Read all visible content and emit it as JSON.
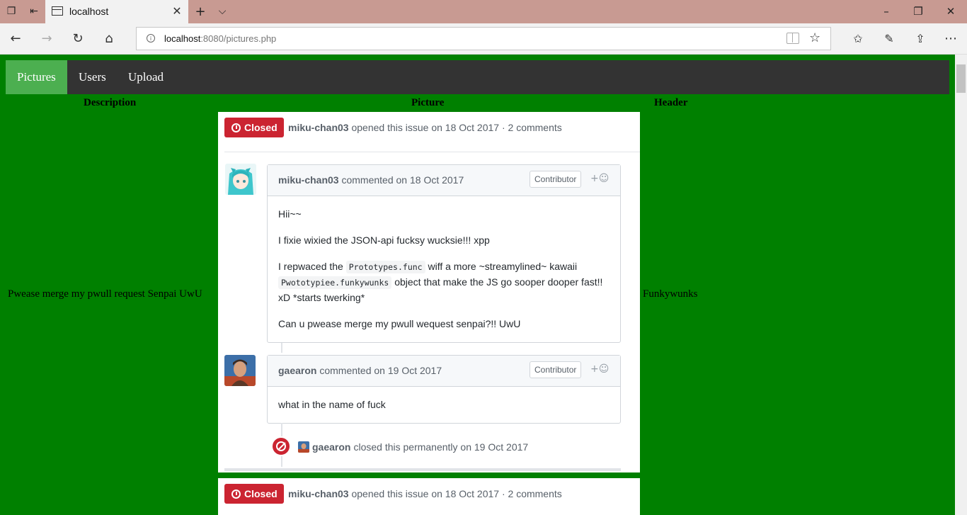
{
  "browser": {
    "tab_title": "localhost",
    "url_host": "localhost",
    "url_path": ":8080/pictures.php"
  },
  "sitenav": {
    "items": [
      "Pictures",
      "Users",
      "Upload"
    ],
    "active": "Pictures"
  },
  "table": {
    "headers": {
      "description": "Description",
      "picture": "Picture",
      "header": "Header"
    },
    "row": {
      "description": "Pwease merge my pwull request Senpai UwU",
      "header": "Funkywunks"
    }
  },
  "issue": {
    "status": "Closed",
    "opener": "miku-chan03",
    "opened_text": "opened this issue on 18 Oct 2017 · 2 comments",
    "comments": [
      {
        "author": "miku-chan03",
        "when": "commented on 18 Oct 2017",
        "badge": "Contributor",
        "react": "+☺",
        "paragraphs": {
          "p1": "Hii~~",
          "p2": "I fixie wixied the JSON-api fucksy wucksie!!! xpp",
          "p3_a": "I repwaced the ",
          "p3_code1": "Prototypes.func",
          "p3_b": " wiff a more ~streamylined~ kawaii ",
          "p3_code2": "Pwototypiee.funkywunks",
          "p3_c": " object that make the JS go sooper dooper fast!! xD *starts twerking*",
          "p4": "Can u pwease merge my pwull wequest senpai?!! UwU"
        }
      },
      {
        "author": "gaearon",
        "when": "commented on 19 Oct 2017",
        "badge": "Contributor",
        "react": "+☺",
        "paragraphs": {
          "p1": "what in the name of fuck"
        }
      }
    ],
    "closed_event": {
      "actor": "gaearon",
      "text": "closed this permanently on 19 Oct 2017"
    }
  },
  "colors": {
    "page_bg": "#008000",
    "nav_bg": "#333333",
    "nav_active": "#4caf50",
    "closed_red": "#cb2431"
  }
}
